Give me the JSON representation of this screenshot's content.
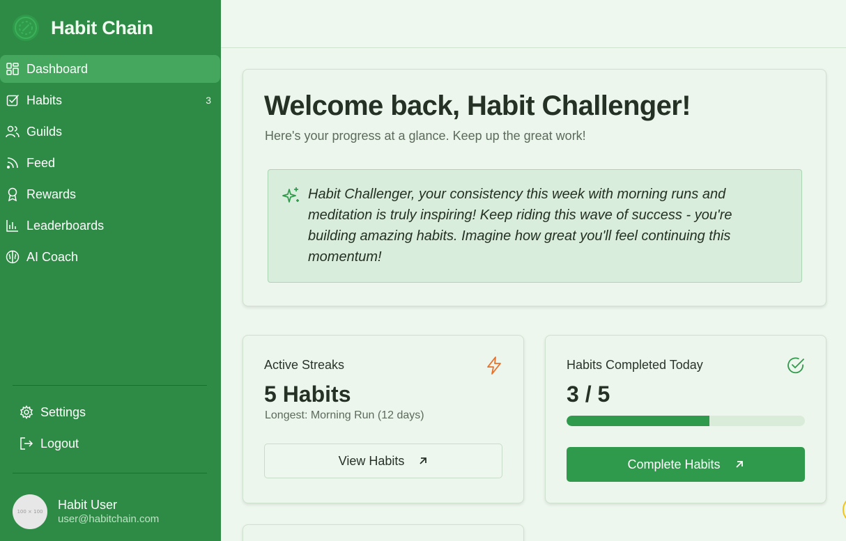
{
  "app": {
    "title": "Habit Chain"
  },
  "sidebar": {
    "items": [
      {
        "label": "Dashboard",
        "icon": "dashboard-icon",
        "active": true
      },
      {
        "label": "Habits",
        "icon": "checkbox-icon",
        "count": "3"
      },
      {
        "label": "Guilds",
        "icon": "users-icon"
      },
      {
        "label": "Feed",
        "icon": "rss-icon"
      },
      {
        "label": "Rewards",
        "icon": "award-icon"
      },
      {
        "label": "Leaderboards",
        "icon": "bar-chart-icon"
      },
      {
        "label": "AI Coach",
        "icon": "brain-icon"
      }
    ],
    "bottom": [
      {
        "label": "Settings",
        "icon": "gear-icon"
      },
      {
        "label": "Logout",
        "icon": "logout-icon"
      }
    ],
    "user": {
      "avatar_text": "100 × 100",
      "name": "Habit User",
      "email": "user@habitchain.com"
    }
  },
  "welcome": {
    "title": "Welcome back, Habit Challenger!",
    "subtitle": "Here's your progress at a glance. Keep up the great work!",
    "message": "Habit Challenger, your consistency this week with morning runs and meditation is truly inspiring! Keep riding this wave of success - you're building amazing habits. Imagine how great you'll feel continuing this momentum!"
  },
  "stats": {
    "streaks": {
      "title": "Active Streaks",
      "value": "5 Habits",
      "sub": "Longest: Morning Run (12 days)",
      "button": "View Habits",
      "icon": "lightning-icon"
    },
    "completed": {
      "title": "Habits Completed Today",
      "value": "3 / 5",
      "progress_fraction": 0.6,
      "button": "Complete Habits",
      "icon": "check-circle-icon"
    }
  },
  "colors": {
    "sidebar": "#2e8b45",
    "accent": "#2f9a4b",
    "streak_icon": "#e8702a",
    "background": "#eef7ee"
  }
}
